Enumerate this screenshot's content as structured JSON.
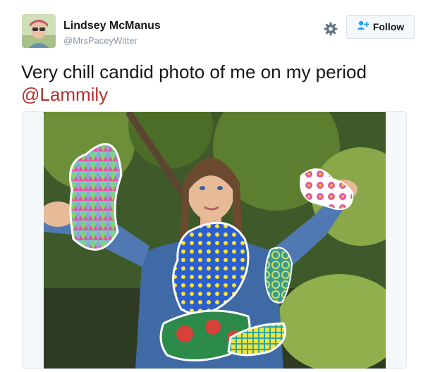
{
  "user": {
    "display_name": "Lindsey McManus",
    "handle": "@MrsPaceyWitter"
  },
  "actions": {
    "settings_icon": "gear-icon",
    "follow_label": "Follow",
    "follow_icon": "follow-person-plus-icon",
    "accent": "#1da1f2"
  },
  "tweet": {
    "text": "Very chill candid photo of me on my period",
    "mention": "@Lammily",
    "mention_color": "#b5312f"
  }
}
